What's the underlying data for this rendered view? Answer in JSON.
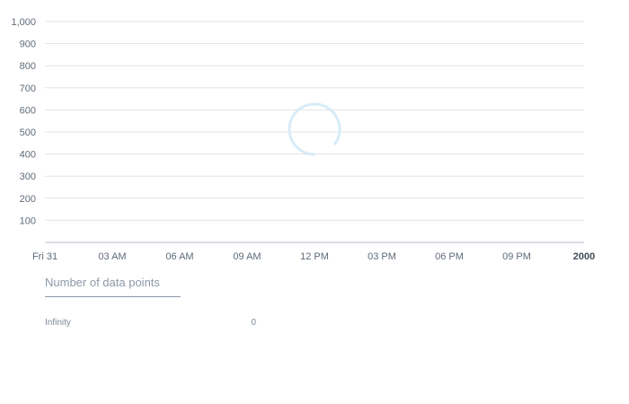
{
  "chart_data": {
    "type": "line",
    "title": "",
    "xlabel": "",
    "ylabel": "",
    "ylim": [
      0,
      1000
    ],
    "y_ticks": [
      "100",
      "200",
      "300",
      "400",
      "500",
      "600",
      "700",
      "800",
      "900",
      "1,000"
    ],
    "y_tick_values": [
      100,
      200,
      300,
      400,
      500,
      600,
      700,
      800,
      900,
      1000
    ],
    "x_ticks": [
      "Fri 31",
      "03 AM",
      "06 AM",
      "09 AM",
      "12 PM",
      "03 PM",
      "06 PM",
      "09 PM",
      "2000"
    ],
    "x_tick_bold_index": 8,
    "grid": true,
    "series": [],
    "loading": true
  },
  "legend": {
    "title": "Number of data points",
    "rows": [
      {
        "label": "Infinity",
        "value": "0"
      }
    ]
  },
  "colors": {
    "grid": "#e0e3e7",
    "axis": "#b6bec9",
    "spinner": "#d7ecf8"
  }
}
